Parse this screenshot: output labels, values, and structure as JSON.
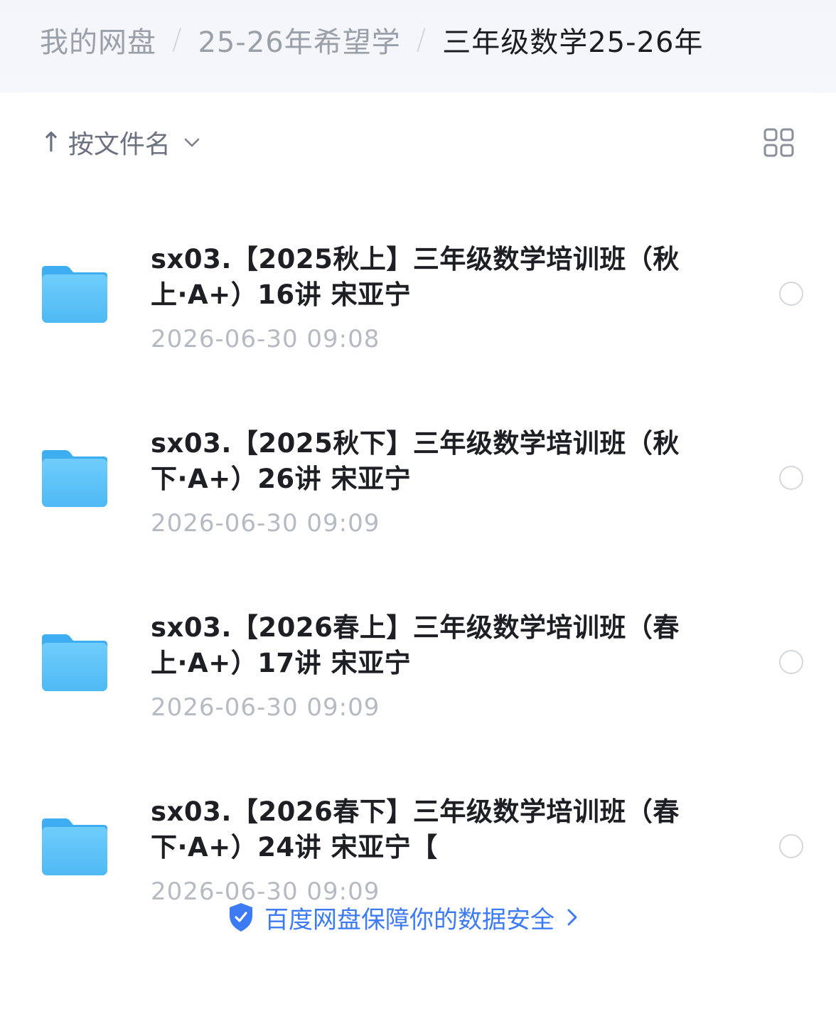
{
  "breadcrumb": {
    "items": [
      "我的网盘",
      "25-26年希望学",
      "三年级数学25-26年"
    ],
    "separator": "/"
  },
  "toolbar": {
    "sort_arrow": "↑",
    "sort_label": "按文件名",
    "view_toggle_icon": "grid-view-icon"
  },
  "files": [
    {
      "name": "sx03.【2025秋上】三年级数学培训班（秋上·A+）16讲 宋亚宁",
      "modified": "2026-06-30 09:08",
      "icon": "folder-icon"
    },
    {
      "name": "sx03.【2025秋下】三年级数学培训班（秋下·A+）26讲 宋亚宁",
      "modified": "2026-06-30 09:09",
      "icon": "folder-icon"
    },
    {
      "name": "sx03.【2026春上】三年级数学培训班（春上·A+）17讲 宋亚宁",
      "modified": "2026-06-30 09:09",
      "icon": "folder-icon"
    },
    {
      "name": "sx03.【2026春下】三年级数学培训班（春下·A+）24讲 宋亚宁【",
      "modified": "2026-06-30 09:09",
      "icon": "folder-icon"
    }
  ],
  "footer": {
    "text": "百度网盘保障你的数据安全",
    "icon": "shield-icon"
  },
  "colors": {
    "folder": "#5cc3f7",
    "link": "#3d7bf5",
    "muted_text": "#9aa0aa",
    "date_text": "#b6bac2"
  }
}
